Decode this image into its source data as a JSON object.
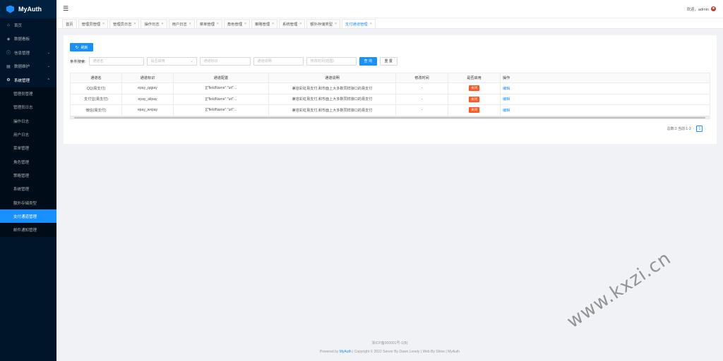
{
  "app": {
    "name": "MyAuth"
  },
  "header": {
    "welcome": "欢迎，admin"
  },
  "sidebar": {
    "items": [
      {
        "label": "首页",
        "icon": "home-icon",
        "arrow": ""
      },
      {
        "label": "数据看板",
        "icon": "dashboard-icon",
        "arrow": ""
      },
      {
        "label": "信息管理",
        "icon": "info-icon",
        "arrow": "⌄"
      },
      {
        "label": "数据维护",
        "icon": "database-icon",
        "arrow": "⌄"
      },
      {
        "label": "系统管理",
        "icon": "gear-icon",
        "arrow": "⌃"
      }
    ],
    "subitems": [
      {
        "label": "管理员管理"
      },
      {
        "label": "管理员日志"
      },
      {
        "label": "操作日志"
      },
      {
        "label": "用户日志"
      },
      {
        "label": "菜单管理"
      },
      {
        "label": "角色管理"
      },
      {
        "label": "策略管理"
      },
      {
        "label": "系统管理"
      },
      {
        "label": "额外存储类型"
      },
      {
        "label": "支付通道管理"
      },
      {
        "label": "邮件通知管理"
      }
    ]
  },
  "tabs": [
    {
      "label": "首页"
    },
    {
      "label": "管理员管理"
    },
    {
      "label": "管理员日志"
    },
    {
      "label": "操作日志"
    },
    {
      "label": "用户日志"
    },
    {
      "label": "菜单管理"
    },
    {
      "label": "角色管理"
    },
    {
      "label": "策略管理"
    },
    {
      "label": "系统管理"
    },
    {
      "label": "额外存储类型"
    },
    {
      "label": "支付通道管理"
    }
  ],
  "toolbar": {
    "refresh_label": "刷新"
  },
  "filter": {
    "label": "条件搜索:",
    "name_placeholder": "通道名",
    "enabled_placeholder": "是否启用",
    "id_placeholder": "通道标识",
    "desc_placeholder": "通道说明",
    "time_placeholder": "修改时间(范围)",
    "search_label": "查 询",
    "reset_label": "重 置"
  },
  "table": {
    "headers": [
      "通道名",
      "通道标识",
      "通道配置",
      "通道说明",
      "修改时间",
      "是否启用",
      "操作"
    ],
    "rows": [
      {
        "name": "QQ(易支付)",
        "id": "epay_qqpay",
        "config": "[{\"fieldName\":\"url\"...",
        "desc": "兼容彩虹易支付,和市面上大多数同样接口的易支付",
        "time": "-",
        "status": "关闭",
        "action": "编辑"
      },
      {
        "name": "支付宝(易支付)",
        "id": "epay_alipay",
        "config": "[{\"fieldName\":\"url\"...",
        "desc": "兼容彩虹易支付,和市面上大多数同样接口的易支付",
        "time": "-",
        "status": "关闭",
        "action": "编辑"
      },
      {
        "name": "微信(易支付)",
        "id": "epay_wxpay",
        "config": "[{\"fieldName\":\"url\"...",
        "desc": "兼容彩虹易支付,和市面上大多数同样接口的易支付",
        "time": "-",
        "status": "关闭",
        "action": "编辑"
      }
    ]
  },
  "pager": {
    "summary": "总数:3 当前:1-3",
    "prev": "‹",
    "page": "1",
    "next": "›"
  },
  "footer": {
    "icp": "浙ICP备000001号-1(B)",
    "powered_prefix": "Powered by ",
    "powered_brand": "MyAuth",
    "powered_suffix": " | Copyright © 2022 Server By Dawn.Lonely | Web By Shine | MyAuth"
  },
  "watermark": "www.kxzi.cn",
  "colors": {
    "primary": "#1890ff",
    "sidebar": "#001529",
    "danger": "#ff5722"
  }
}
